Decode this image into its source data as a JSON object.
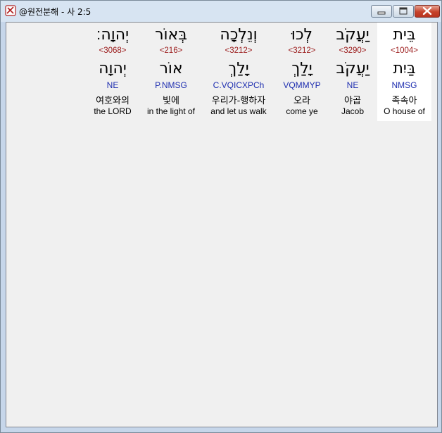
{
  "window": {
    "title": "@원전분해 - 사 2:5"
  },
  "words": [
    {
      "hebrew": "בֵּית",
      "strong": "<1004>",
      "lemma": "בַּיִת",
      "morph": "NMSG",
      "korean": "족속아",
      "english": "O house of",
      "selected": true
    },
    {
      "hebrew": "יַעֲקֹב",
      "strong": "<3290>",
      "lemma": "יַעֲקֹב",
      "morph": "NE",
      "korean": "야곱",
      "english": "Jacob",
      "selected": false
    },
    {
      "hebrew": "לְכוּ",
      "strong": "<3212>",
      "lemma": "יָלַךְ",
      "morph": "VQMMYP",
      "korean": "오라",
      "english": "come ye",
      "selected": false
    },
    {
      "hebrew": "וְנֵלְכָה",
      "strong": "<3212>",
      "lemma": "יָלַךְ",
      "morph": "C.VQICXPCh",
      "korean": "우리가-행하자",
      "english": "and let us walk",
      "selected": false
    },
    {
      "hebrew": "בְּאוֹר",
      "strong": "<216>",
      "lemma": "אוֹר",
      "morph": "P.NMSG",
      "korean": "빛에",
      "english": "in the light of",
      "selected": false
    },
    {
      "hebrew": "יְהוָה׃",
      "strong": "<3068>",
      "lemma": "יְהוָה",
      "morph": "NE",
      "korean": "여호와의",
      "english": "the LORD",
      "selected": false
    }
  ]
}
